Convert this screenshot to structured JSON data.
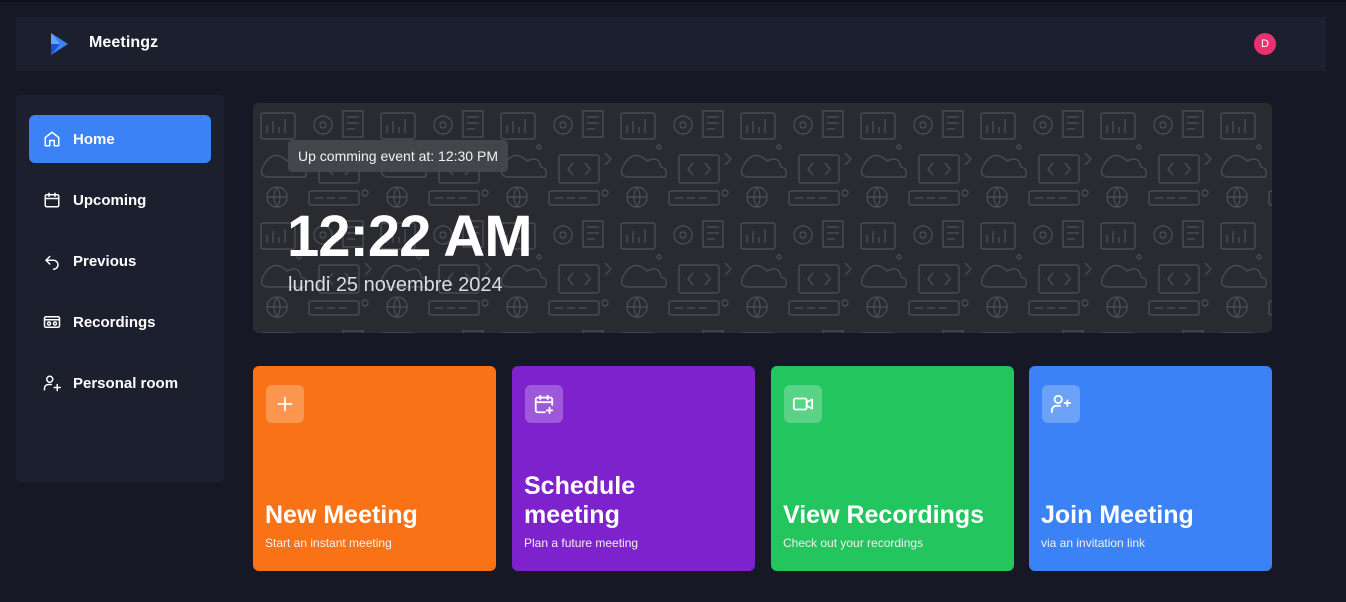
{
  "app": {
    "name": "Meetingz",
    "user_initial": "D"
  },
  "colors": {
    "background": "#161925",
    "panel": "#1c1f2e",
    "accent": "#3b82f6",
    "avatar": "#e8326f",
    "card_new": "#f97316",
    "card_schedule": "#7e22ce",
    "card_recordings": "#22c55e",
    "card_join": "#3b82f6"
  },
  "sidebar": {
    "items": [
      {
        "label": "Home",
        "icon": "home-icon",
        "active": true
      },
      {
        "label": "Upcoming",
        "icon": "calendar-icon",
        "active": false
      },
      {
        "label": "Previous",
        "icon": "undo-arrow-icon",
        "active": false
      },
      {
        "label": "Recordings",
        "icon": "video-recording-icon",
        "active": false
      },
      {
        "label": "Personal room",
        "icon": "user-plus-icon",
        "active": false
      }
    ]
  },
  "hero": {
    "upcoming": "Up comming event at: 12:30 PM",
    "time": "12:22 AM",
    "date": "lundi 25 novembre 2024"
  },
  "cards": [
    {
      "title": "New Meeting",
      "subtitle": "Start an instant meeting",
      "icon": "plus-icon"
    },
    {
      "title": "Schedule meeting",
      "subtitle": "Plan a future meeting",
      "icon": "calendar-plus-icon"
    },
    {
      "title": "View Recordings",
      "subtitle": "Check out your recordings",
      "icon": "video-icon"
    },
    {
      "title": "Join Meeting",
      "subtitle": "via an invitation link",
      "icon": "user-plus-icon"
    }
  ]
}
